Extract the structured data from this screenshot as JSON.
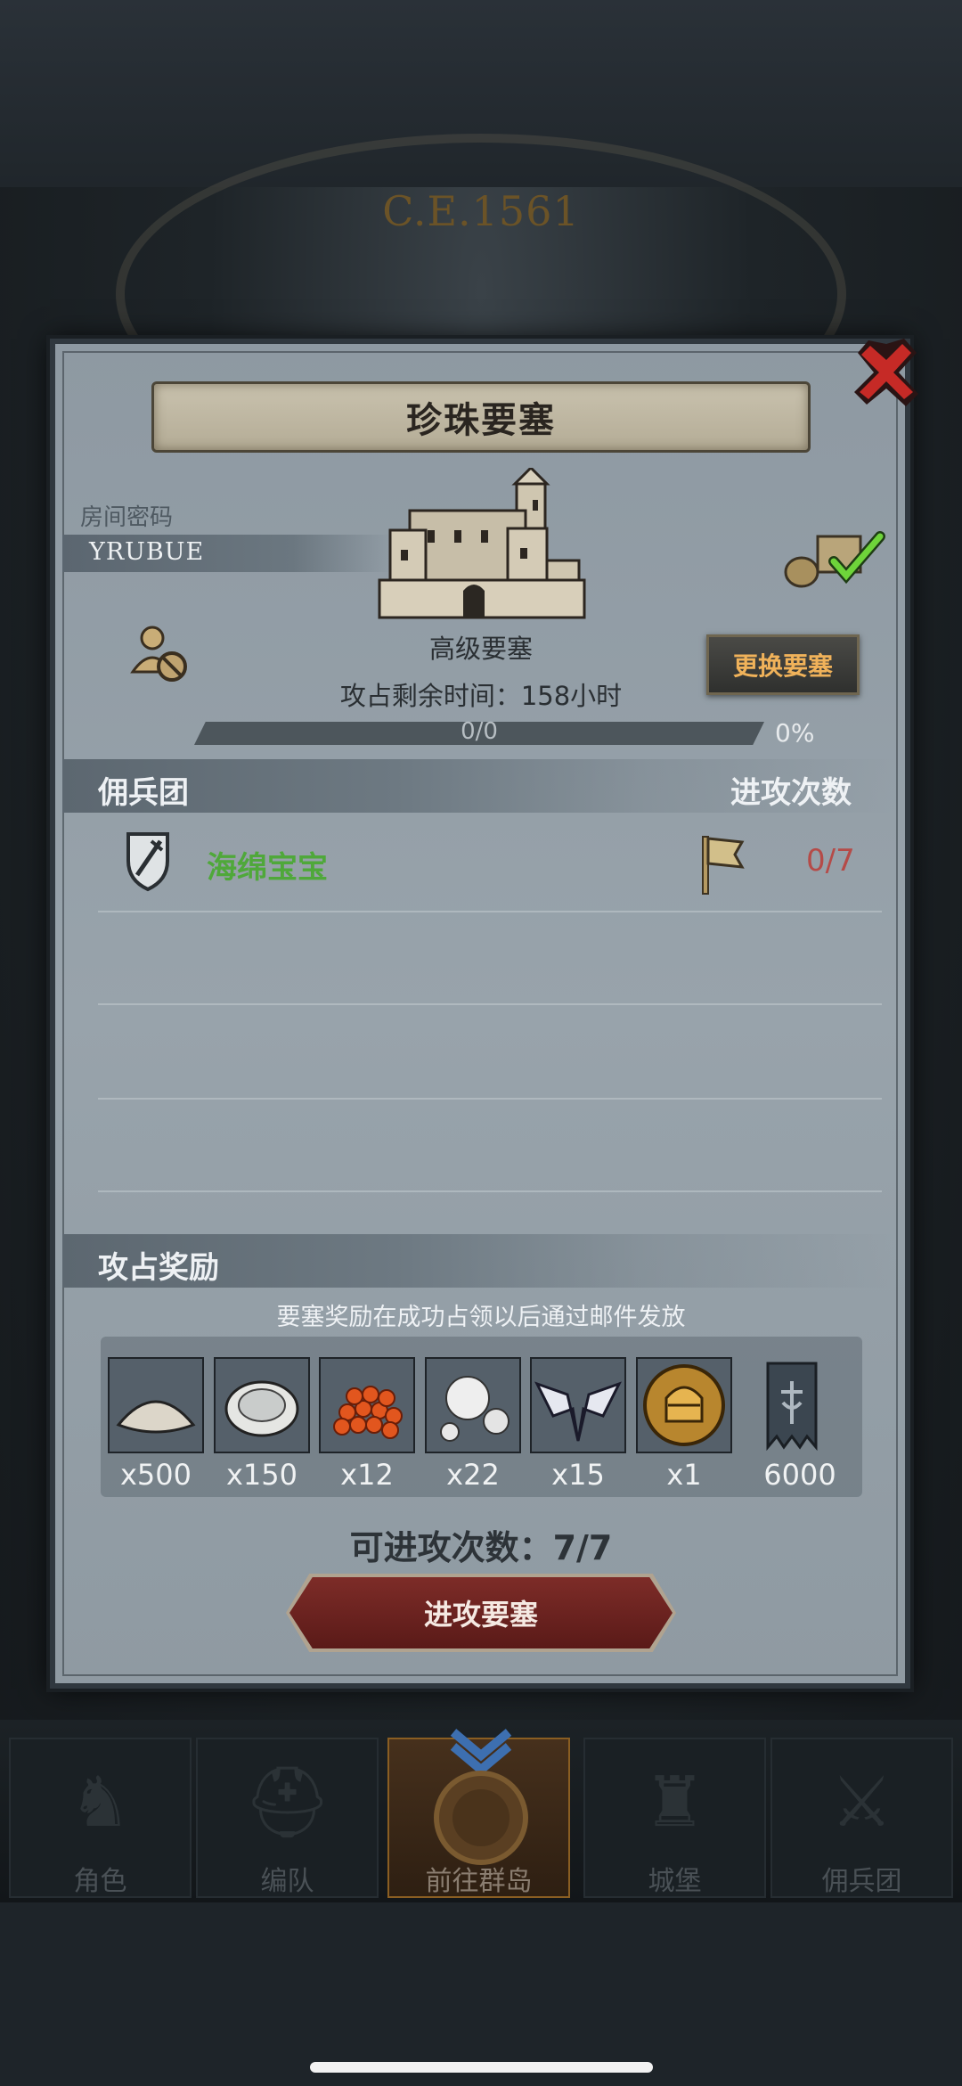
{
  "background": {
    "era": "C.E.1561"
  },
  "dialog": {
    "title": "珍珠要塞",
    "room_code_label": "房间密码",
    "room_code": "YRUBUE",
    "fortress_level": "高级要塞",
    "time_remaining": "攻占剩余时间：158小时",
    "change_button": "更换要塞",
    "progress": {
      "text": "0/0",
      "percent_text": "0%",
      "fraction": 0
    },
    "mercenary_header": "佣兵团",
    "attack_count_header": "进攻次数",
    "mercenaries": [
      {
        "name": "海绵宝宝",
        "attacks": "0/7"
      }
    ],
    "reward_header": "攻占奖励",
    "reward_note": "要塞奖励在成功占领以后通过邮件发放",
    "rewards": [
      {
        "icon": "salt-pile-icon",
        "qty": "x500"
      },
      {
        "icon": "oyster-icon",
        "qty": "x150"
      },
      {
        "icon": "fish-roe-icon",
        "qty": "x12"
      },
      {
        "icon": "pearls-icon",
        "qty": "x22"
      },
      {
        "icon": "winged-emblem-icon",
        "qty": "x15"
      },
      {
        "icon": "knight-helmet-coin-icon",
        "qty": "x1"
      },
      {
        "icon": "guild-banner-icon",
        "qty": "6000"
      }
    ],
    "attempts": "可进攻次数：7/7",
    "attack_button": "进攻要塞"
  },
  "nav": {
    "tabs": [
      {
        "label": "角色",
        "icon": "knight-icon"
      },
      {
        "label": "编队",
        "icon": "helmet-icon"
      },
      {
        "label": "前往群岛",
        "icon": "compass-icon",
        "active": true
      },
      {
        "label": "城堡",
        "icon": "castle-icon"
      },
      {
        "label": "佣兵团",
        "icon": "mercenary-icon"
      }
    ]
  },
  "colors": {
    "merc_name": "#4fa83a",
    "attack_count": "#b54b48",
    "change_button_text": "#f0b25a",
    "attack_button": "#6e2420"
  }
}
